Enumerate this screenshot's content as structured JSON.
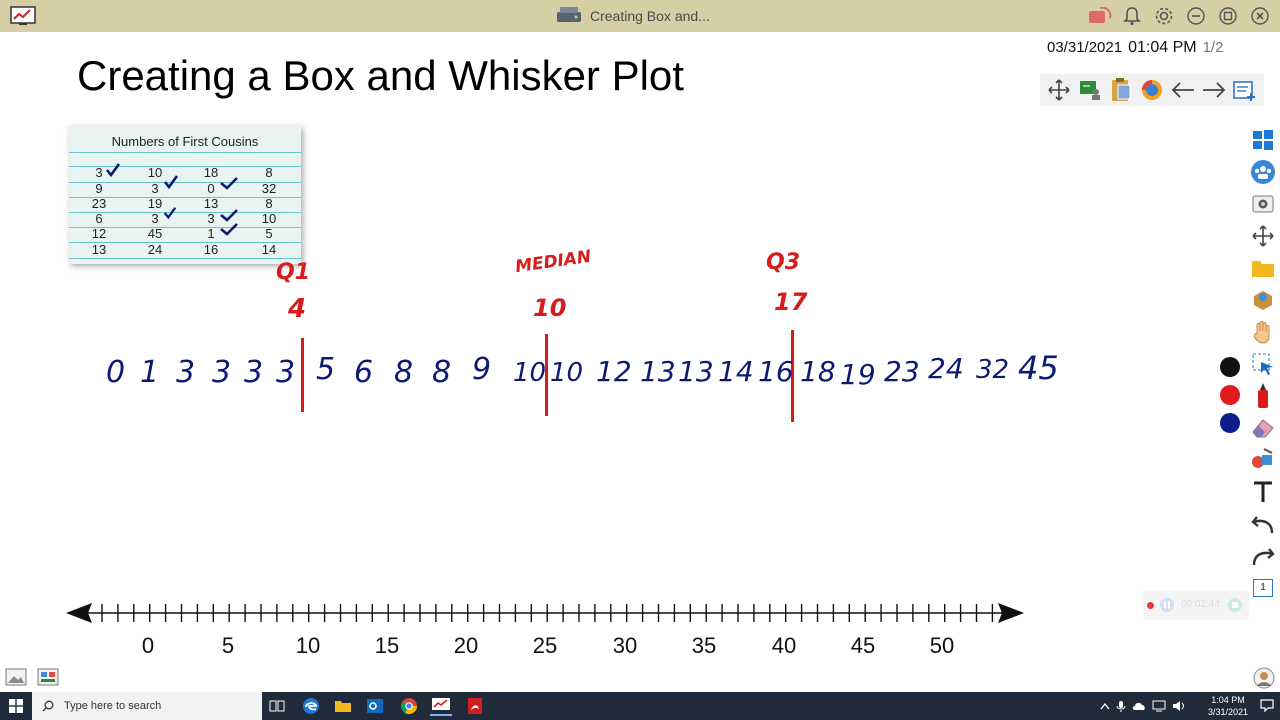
{
  "window": {
    "title": "Creating Box and...",
    "colors": {
      "titlebar": "#d6cfa6",
      "ink_blue": "#0d1a73",
      "ink_red": "#d81c1c"
    }
  },
  "header": {
    "date": "03/31/2021",
    "time": "01:04 PM",
    "page": "1/2"
  },
  "slide": {
    "title": "Creating a Box and Whisker Plot"
  },
  "table": {
    "title": "Numbers of First Cousins",
    "rows": [
      [
        "3",
        "10",
        "18",
        "8"
      ],
      [
        "9",
        "3",
        "0",
        "32"
      ],
      [
        "23",
        "19",
        "13",
        "8"
      ],
      [
        "6",
        "3",
        "3",
        "10"
      ],
      [
        "12",
        "45",
        "1",
        "5"
      ],
      [
        "13",
        "24",
        "16",
        "14"
      ]
    ]
  },
  "annotations": {
    "q1_label": "Q1",
    "q1_value": "4",
    "median_label": "MEDIAN",
    "median_value": "10",
    "q3_label": "Q3",
    "q3_value": "17"
  },
  "ordered_values": [
    "0",
    "1",
    "3",
    "3",
    "3",
    "3",
    "5",
    "6",
    "8",
    "8",
    "9",
    "10",
    "10",
    "12",
    "13",
    "13",
    "14",
    "16",
    "18",
    "19",
    "23",
    "24",
    "32",
    "45"
  ],
  "number_line": {
    "labels": [
      "0",
      "5",
      "10",
      "15",
      "20",
      "25",
      "30",
      "35",
      "40",
      "45",
      "50"
    ]
  },
  "recording": {
    "elapsed": "00:02:44"
  },
  "side_toolbar": {
    "page_number": "1",
    "pen_colors": [
      "#111111",
      "#e01b1b",
      "#0b1c8c"
    ]
  },
  "taskbar": {
    "search_placeholder": "Type here to search",
    "clock_time": "1:04 PM",
    "clock_date": "3/31/2021"
  }
}
